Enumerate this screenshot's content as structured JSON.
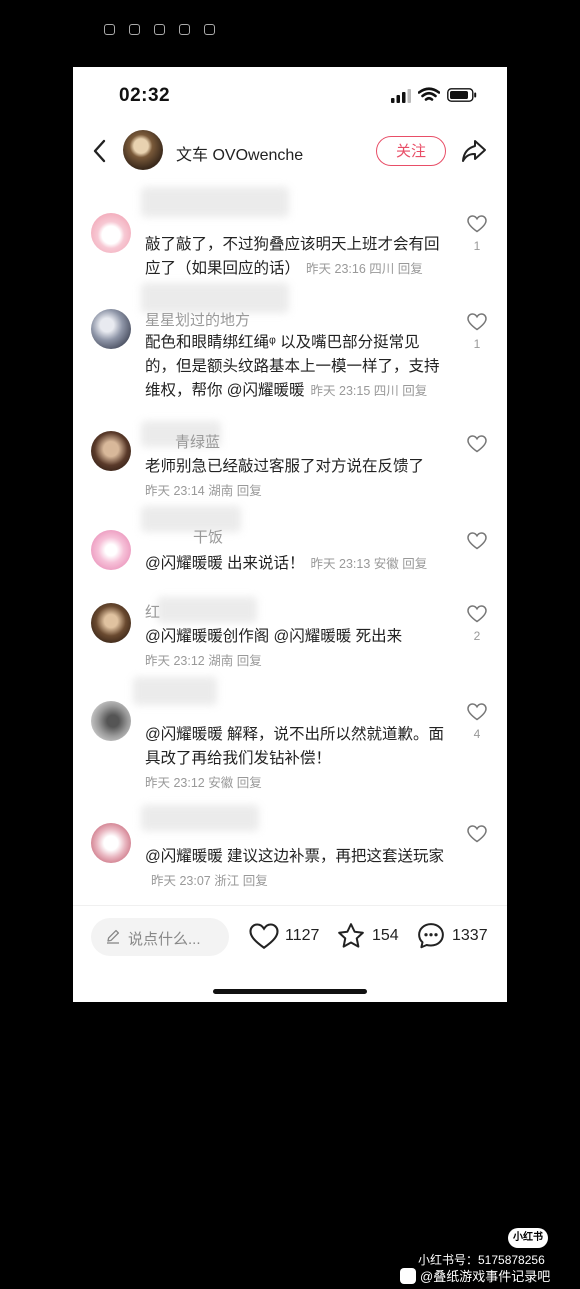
{
  "status_bar": {
    "time": "02:32"
  },
  "header": {
    "author_name": "文车 OVOwenche",
    "follow_label": "关注"
  },
  "comments": [
    {
      "user": "",
      "text": "敲了敲了，不过狗叠应该明天上班才会有回应了（如果回应的话）",
      "meta": "昨天 23:16 四川 回复",
      "likes": "1"
    },
    {
      "user": "星星划过的地方",
      "text": "配色和眼睛绑红绳ᵠ 以及嘴巴部分挺常见的，但是额头纹路基本上一模一样了，支持维权，帮你 @闪耀暖暖",
      "meta": "昨天 23:15 四川 回复",
      "likes": "1"
    },
    {
      "user": "青绿蓝",
      "text": "老师别急已经敲过客服了对方说在反馈了",
      "meta": "昨天 23:14 湖南 回复",
      "likes": ""
    },
    {
      "user": "干饭",
      "text": "@闪耀暖暖 出来说话！",
      "meta": "昨天 23:13 安徽 回复",
      "likes": ""
    },
    {
      "user": "红",
      "text": "@闪耀暖暖创作阁 @闪耀暖暖 死出来",
      "meta": "昨天 23:12 湖南 回复",
      "likes": "2"
    },
    {
      "user": "",
      "text": "@闪耀暖暖 解释，说不出所以然就道歉。面具改了再给我们发钻补偿！",
      "meta": "昨天 23:12 安徽 回复",
      "likes": "4"
    },
    {
      "user": "",
      "text": "@闪耀暖暖 建议这边补票，再把这套送玩家",
      "meta": "昨天 23:07 浙江 回复",
      "likes": ""
    }
  ],
  "bottom_bar": {
    "input_placeholder": "说点什么...",
    "likes": "1127",
    "favorites": "154",
    "comments": "1337"
  },
  "watermark": {
    "badge": "小红书",
    "id_line": "小红书号：5175878256",
    "account": "@叠纸游戏事件记录吧"
  },
  "colors": {
    "accent": "#e84e67",
    "text": "#222222",
    "meta": "#999999"
  }
}
